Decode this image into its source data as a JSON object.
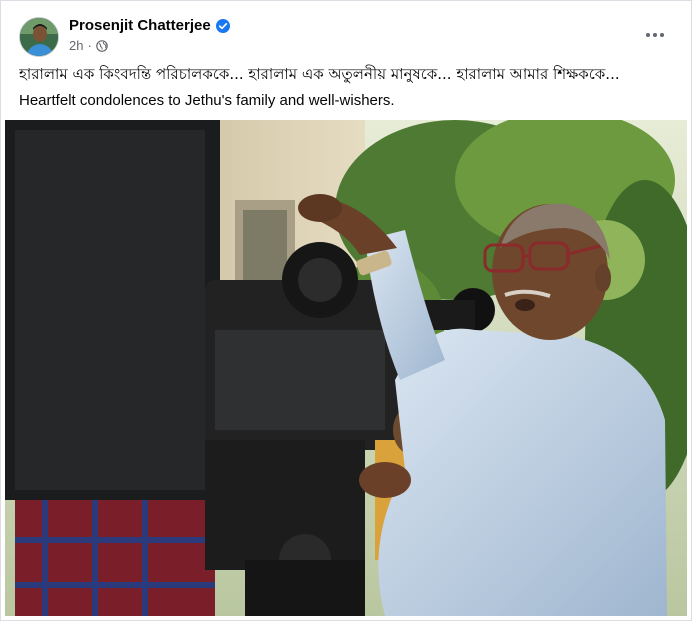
{
  "post": {
    "author_name": "Prosenjit Chatterjee",
    "verified": true,
    "timestamp": "2h",
    "separator": "·",
    "privacy_icon": "globe-icon",
    "more_icon": "more-options-icon",
    "text_bengali": "হারালাম এক কিংবদন্তি পরিচালককে... হারালাম এক অতুলনীয় মানুষকে... হারালাম আমার শিক্ষককে...",
    "text_english": "Heartfelt condolences to Jethu's family and well-wishers.",
    "image_icon": "photo-of-director-with-movie-camera"
  },
  "colors": {
    "verified_blue": "#1877f2",
    "meta_gray": "#65676b",
    "text": "#050505"
  }
}
